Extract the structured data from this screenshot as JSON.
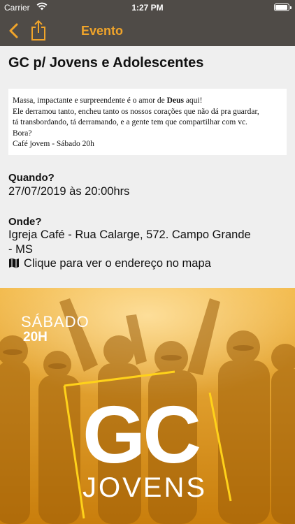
{
  "status_bar": {
    "carrier": "Carrier",
    "time": "1:27 PM",
    "battery_icon": "battery-icon",
    "wifi_icon": "wifi-icon"
  },
  "nav": {
    "title": "Evento",
    "back_icon": "chevron-left-icon",
    "share_icon": "share-icon",
    "accent_color": "#f0a42a",
    "bar_color": "#4f4b47"
  },
  "event": {
    "title": "GC p/ Jovens e Adolescentes",
    "description": {
      "line1_prefix": "Massa, impactante e surpreendente é o amor de ",
      "line1_bold": "Deus",
      "line1_suffix": " aqui!",
      "line2": "Ele derramou tanto, encheu tanto os nossos corações que não dá pra guardar,",
      "line3": "tá transbordando, tá derramando, e a gente tem que compartilhar com vc.",
      "line4": "Bora?",
      "line5": "Café jovem - Sábado 20h"
    },
    "when_label": "Quando?",
    "when_value": "27/07/2019 às 20:00hrs",
    "where_label": "Onde?",
    "where_value_line1": "Igreja Café - Rua Calarge, 572. Campo Grande",
    "where_value_line2": "- MS",
    "map_link": "Clique para ver o endereço no mapa",
    "map_icon": "map-icon"
  },
  "banner": {
    "day": "SÁBADO",
    "hour": "20H",
    "logo_main": "GC",
    "logo_sub": "JOVENS",
    "tint_color": "#e29b18"
  }
}
